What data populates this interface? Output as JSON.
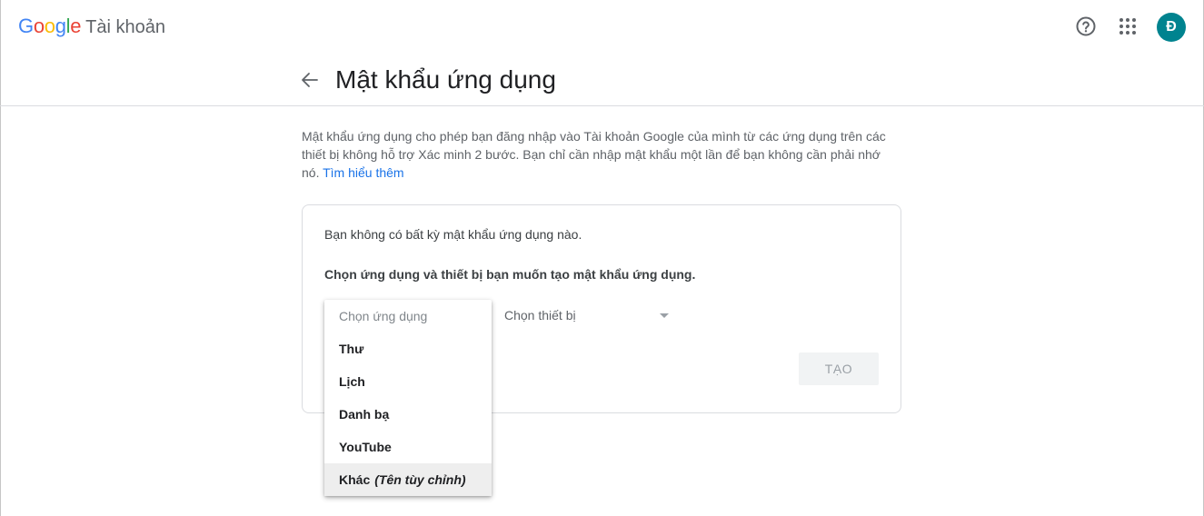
{
  "header": {
    "brand_google": [
      "G",
      "o",
      "o",
      "g",
      "l",
      "e"
    ],
    "brand_product": "Tài khoản",
    "help_icon": "help-circle-icon",
    "apps_icon": "apps-grid-icon",
    "avatar_initial": "Đ",
    "avatar_color": "#00838f"
  },
  "page": {
    "title": "Mật khẩu ứng dụng",
    "back_icon": "arrow-back-icon",
    "description": "Mật khẩu ứng dụng cho phép bạn đăng nhập vào Tài khoản Google của mình từ các ứng dụng trên các thiết bị không hỗ trợ Xác minh 2 bước. Bạn chỉ cần nhập mật khẩu một lần để bạn không cần phải nhớ nó.",
    "learn_more": "Tìm hiểu thêm"
  },
  "card": {
    "no_passwords": "Bạn không có bất kỳ mật khẩu ứng dụng nào.",
    "choose_label": "Chọn ứng dụng và thiết bị bạn muốn tạo mật khẩu ứng dụng.",
    "device_select": {
      "placeholder": "Chọn thiết bị"
    },
    "create_button": "TẠO",
    "app_menu": {
      "placeholder": "Chọn ứng dụng",
      "items": [
        {
          "label": "Thư"
        },
        {
          "label": "Lịch"
        },
        {
          "label": "Danh bạ"
        },
        {
          "label": "YouTube"
        },
        {
          "label": "Khác",
          "hint": "(Tên tùy chỉnh)"
        }
      ]
    }
  },
  "colors": {
    "accent_link": "#1a73e8",
    "google_blue": "#4285f4",
    "google_red": "#ea4335",
    "google_yellow": "#fbbc05",
    "google_green": "#34a853"
  }
}
